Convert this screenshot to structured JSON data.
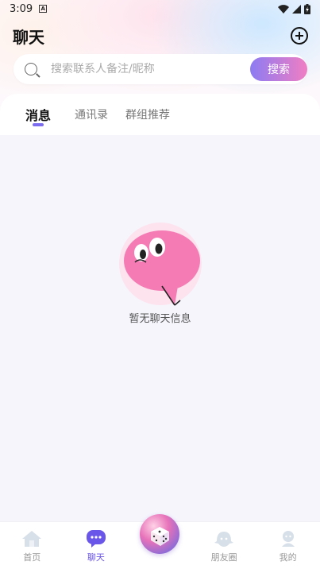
{
  "status_bar": {
    "time": "3:09",
    "badge": "A"
  },
  "header": {
    "title": "聊天"
  },
  "search": {
    "placeholder": "搜索联系人备注/昵称",
    "button_label": "搜索"
  },
  "tabs": [
    {
      "label": "消息",
      "active": true
    },
    {
      "label": "通讯录",
      "active": false
    },
    {
      "label": "群组推荐",
      "active": false
    }
  ],
  "empty_state": {
    "text": "暂无聊天信息"
  },
  "bottom_nav": {
    "items": [
      {
        "label": "首页",
        "icon": "home-icon",
        "active": false
      },
      {
        "label": "聊天",
        "icon": "chat-icon",
        "active": true
      },
      {
        "label": "朋友圈",
        "icon": "ghost-icon",
        "active": false
      },
      {
        "label": "我的",
        "icon": "profile-icon",
        "active": false
      }
    ],
    "center_icon": "dice-icon"
  },
  "colors": {
    "accent": "#6a56e8",
    "gradient_start": "#8c7bf2",
    "gradient_end": "#f07ec3",
    "bubble": "#f47bb4"
  }
}
